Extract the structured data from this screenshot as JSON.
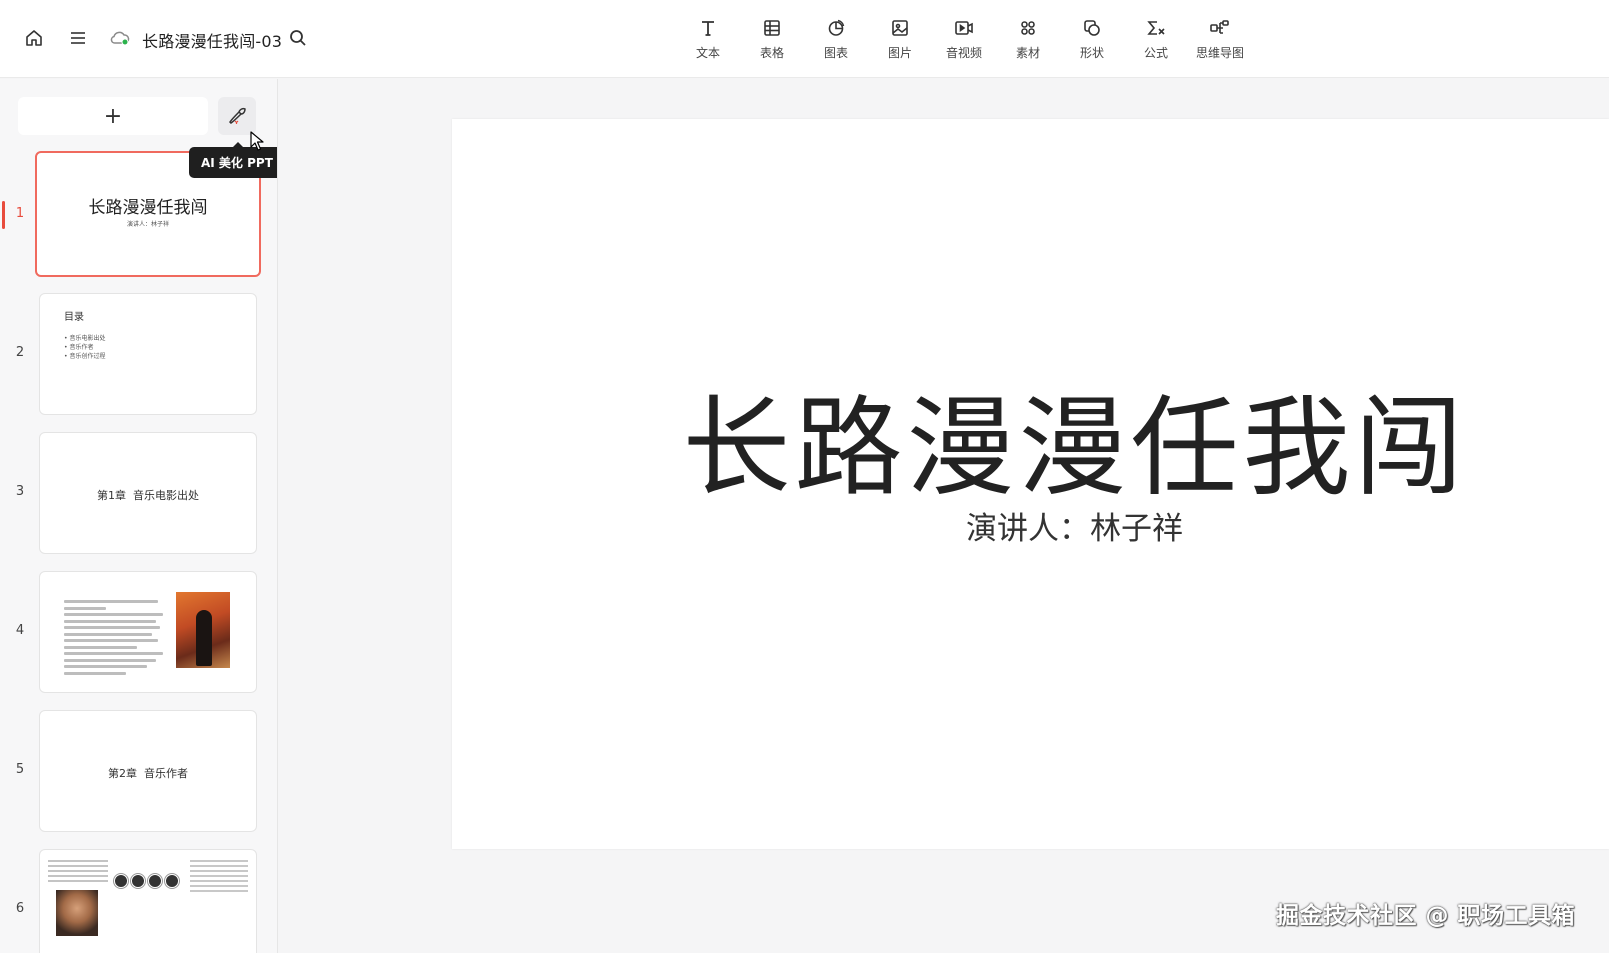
{
  "header": {
    "title": "长路漫漫任我闯-03",
    "cloud_status_color": "#2bb24c"
  },
  "toolbar": [
    {
      "label": "文本",
      "icon": "text-icon"
    },
    {
      "label": "表格",
      "icon": "table-icon"
    },
    {
      "label": "图表",
      "icon": "chart-icon"
    },
    {
      "label": "图片",
      "icon": "image-icon"
    },
    {
      "label": "音视频",
      "icon": "video-icon"
    },
    {
      "label": "素材",
      "icon": "material-icon"
    },
    {
      "label": "形状",
      "icon": "shape-icon"
    },
    {
      "label": "公式",
      "icon": "formula-icon"
    },
    {
      "label": "思维导图",
      "icon": "mindmap-icon"
    }
  ],
  "sidebar": {
    "add_label": "+",
    "ai_tooltip": "AI 美化 PPT",
    "accent_color": "#e84c3d",
    "slides": [
      {
        "num": "1",
        "title": "长路漫漫任我闯",
        "subtitle": "演讲人：林子祥"
      },
      {
        "num": "2",
        "title": "目录",
        "items": [
          "音乐电影出处",
          "音乐作者",
          "音乐创作过程"
        ]
      },
      {
        "num": "3",
        "title": "第1章  音乐电影出处"
      },
      {
        "num": "4"
      },
      {
        "num": "5",
        "title": "第2章  音乐作者"
      },
      {
        "num": "6"
      }
    ]
  },
  "slide": {
    "title": "长路漫漫任我闯",
    "subtitle": "演讲人：林子祥"
  },
  "watermark": "掘金技术社区 @ 职场工具箱"
}
